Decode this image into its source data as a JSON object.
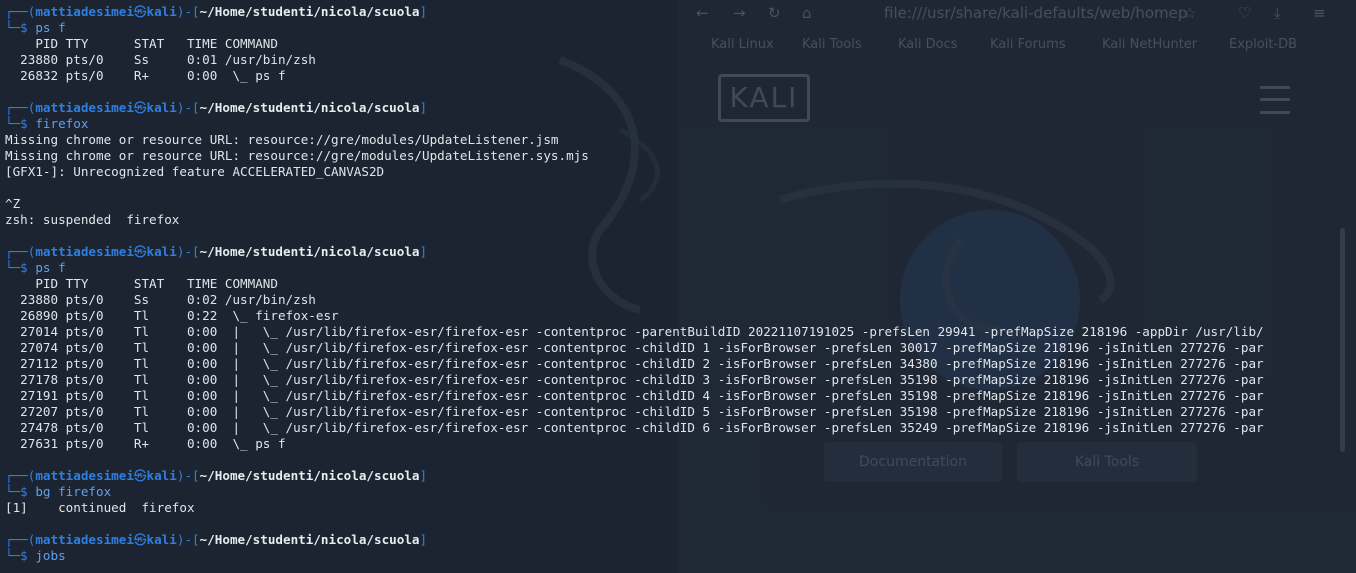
{
  "browser": {
    "url": "file:///usr/share/kali-defaults/web/homep",
    "bookmarks": [
      "Kali Linux",
      "Kali Tools",
      "Kali Docs",
      "Kali Forums",
      "Kali NetHunter",
      "Exploit-DB"
    ],
    "logo_text": "KALI",
    "buttons": [
      "Documentation",
      "Kali Tools"
    ]
  },
  "terminal": {
    "prompt": {
      "user": "mattiadesimei",
      "at_symbol": "㉿",
      "host": "kali",
      "cwd": "~/Home/studenti/nicola/scuola"
    },
    "blocks": [
      {
        "command": "ps f",
        "output": [
          "    PID TTY      STAT   TIME COMMAND",
          "  23880 pts/0    Ss     0:01 /usr/bin/zsh",
          "  26832 pts/0    R+     0:00  \\_ ps f"
        ]
      },
      {
        "command": "firefox",
        "output": [
          "Missing chrome or resource URL: resource://gre/modules/UpdateListener.jsm",
          "Missing chrome or resource URL: resource://gre/modules/UpdateListener.sys.mjs",
          "[GFX1-]: Unrecognized feature ACCELERATED_CANVAS2D",
          "",
          "^Z",
          "zsh: suspended  firefox"
        ]
      },
      {
        "command": "ps f",
        "output": [
          "    PID TTY      STAT   TIME COMMAND",
          "  23880 pts/0    Ss     0:02 /usr/bin/zsh",
          "  26890 pts/0    Tl     0:22  \\_ firefox-esr",
          "  27014 pts/0    Tl     0:00  |   \\_ /usr/lib/firefox-esr/firefox-esr -contentproc -parentBuildID 20221107191025 -prefsLen 29941 -prefMapSize 218196 -appDir /usr/lib/",
          "  27074 pts/0    Tl     0:00  |   \\_ /usr/lib/firefox-esr/firefox-esr -contentproc -childID 1 -isForBrowser -prefsLen 30017 -prefMapSize 218196 -jsInitLen 277276 -par",
          "  27112 pts/0    Tl     0:00  |   \\_ /usr/lib/firefox-esr/firefox-esr -contentproc -childID 2 -isForBrowser -prefsLen 34380 -prefMapSize 218196 -jsInitLen 277276 -par",
          "  27178 pts/0    Tl     0:00  |   \\_ /usr/lib/firefox-esr/firefox-esr -contentproc -childID 3 -isForBrowser -prefsLen 35198 -prefMapSize 218196 -jsInitLen 277276 -par",
          "  27191 pts/0    Tl     0:00  |   \\_ /usr/lib/firefox-esr/firefox-esr -contentproc -childID 4 -isForBrowser -prefsLen 35198 -prefMapSize 218196 -jsInitLen 277276 -par",
          "  27207 pts/0    Tl     0:00  |   \\_ /usr/lib/firefox-esr/firefox-esr -contentproc -childID 5 -isForBrowser -prefsLen 35198 -prefMapSize 218196 -jsInitLen 277276 -par",
          "  27478 pts/0    Tl     0:00  |   \\_ /usr/lib/firefox-esr/firefox-esr -contentproc -childID 6 -isForBrowser -prefsLen 35249 -prefMapSize 218196 -jsInitLen 277276 -par",
          "  27631 pts/0    R+     0:00  \\_ ps f"
        ]
      },
      {
        "command": "bg firefox",
        "output": [
          "[1]    continued  firefox",
          ""
        ]
      },
      {
        "command": "jobs",
        "output": []
      }
    ]
  }
}
